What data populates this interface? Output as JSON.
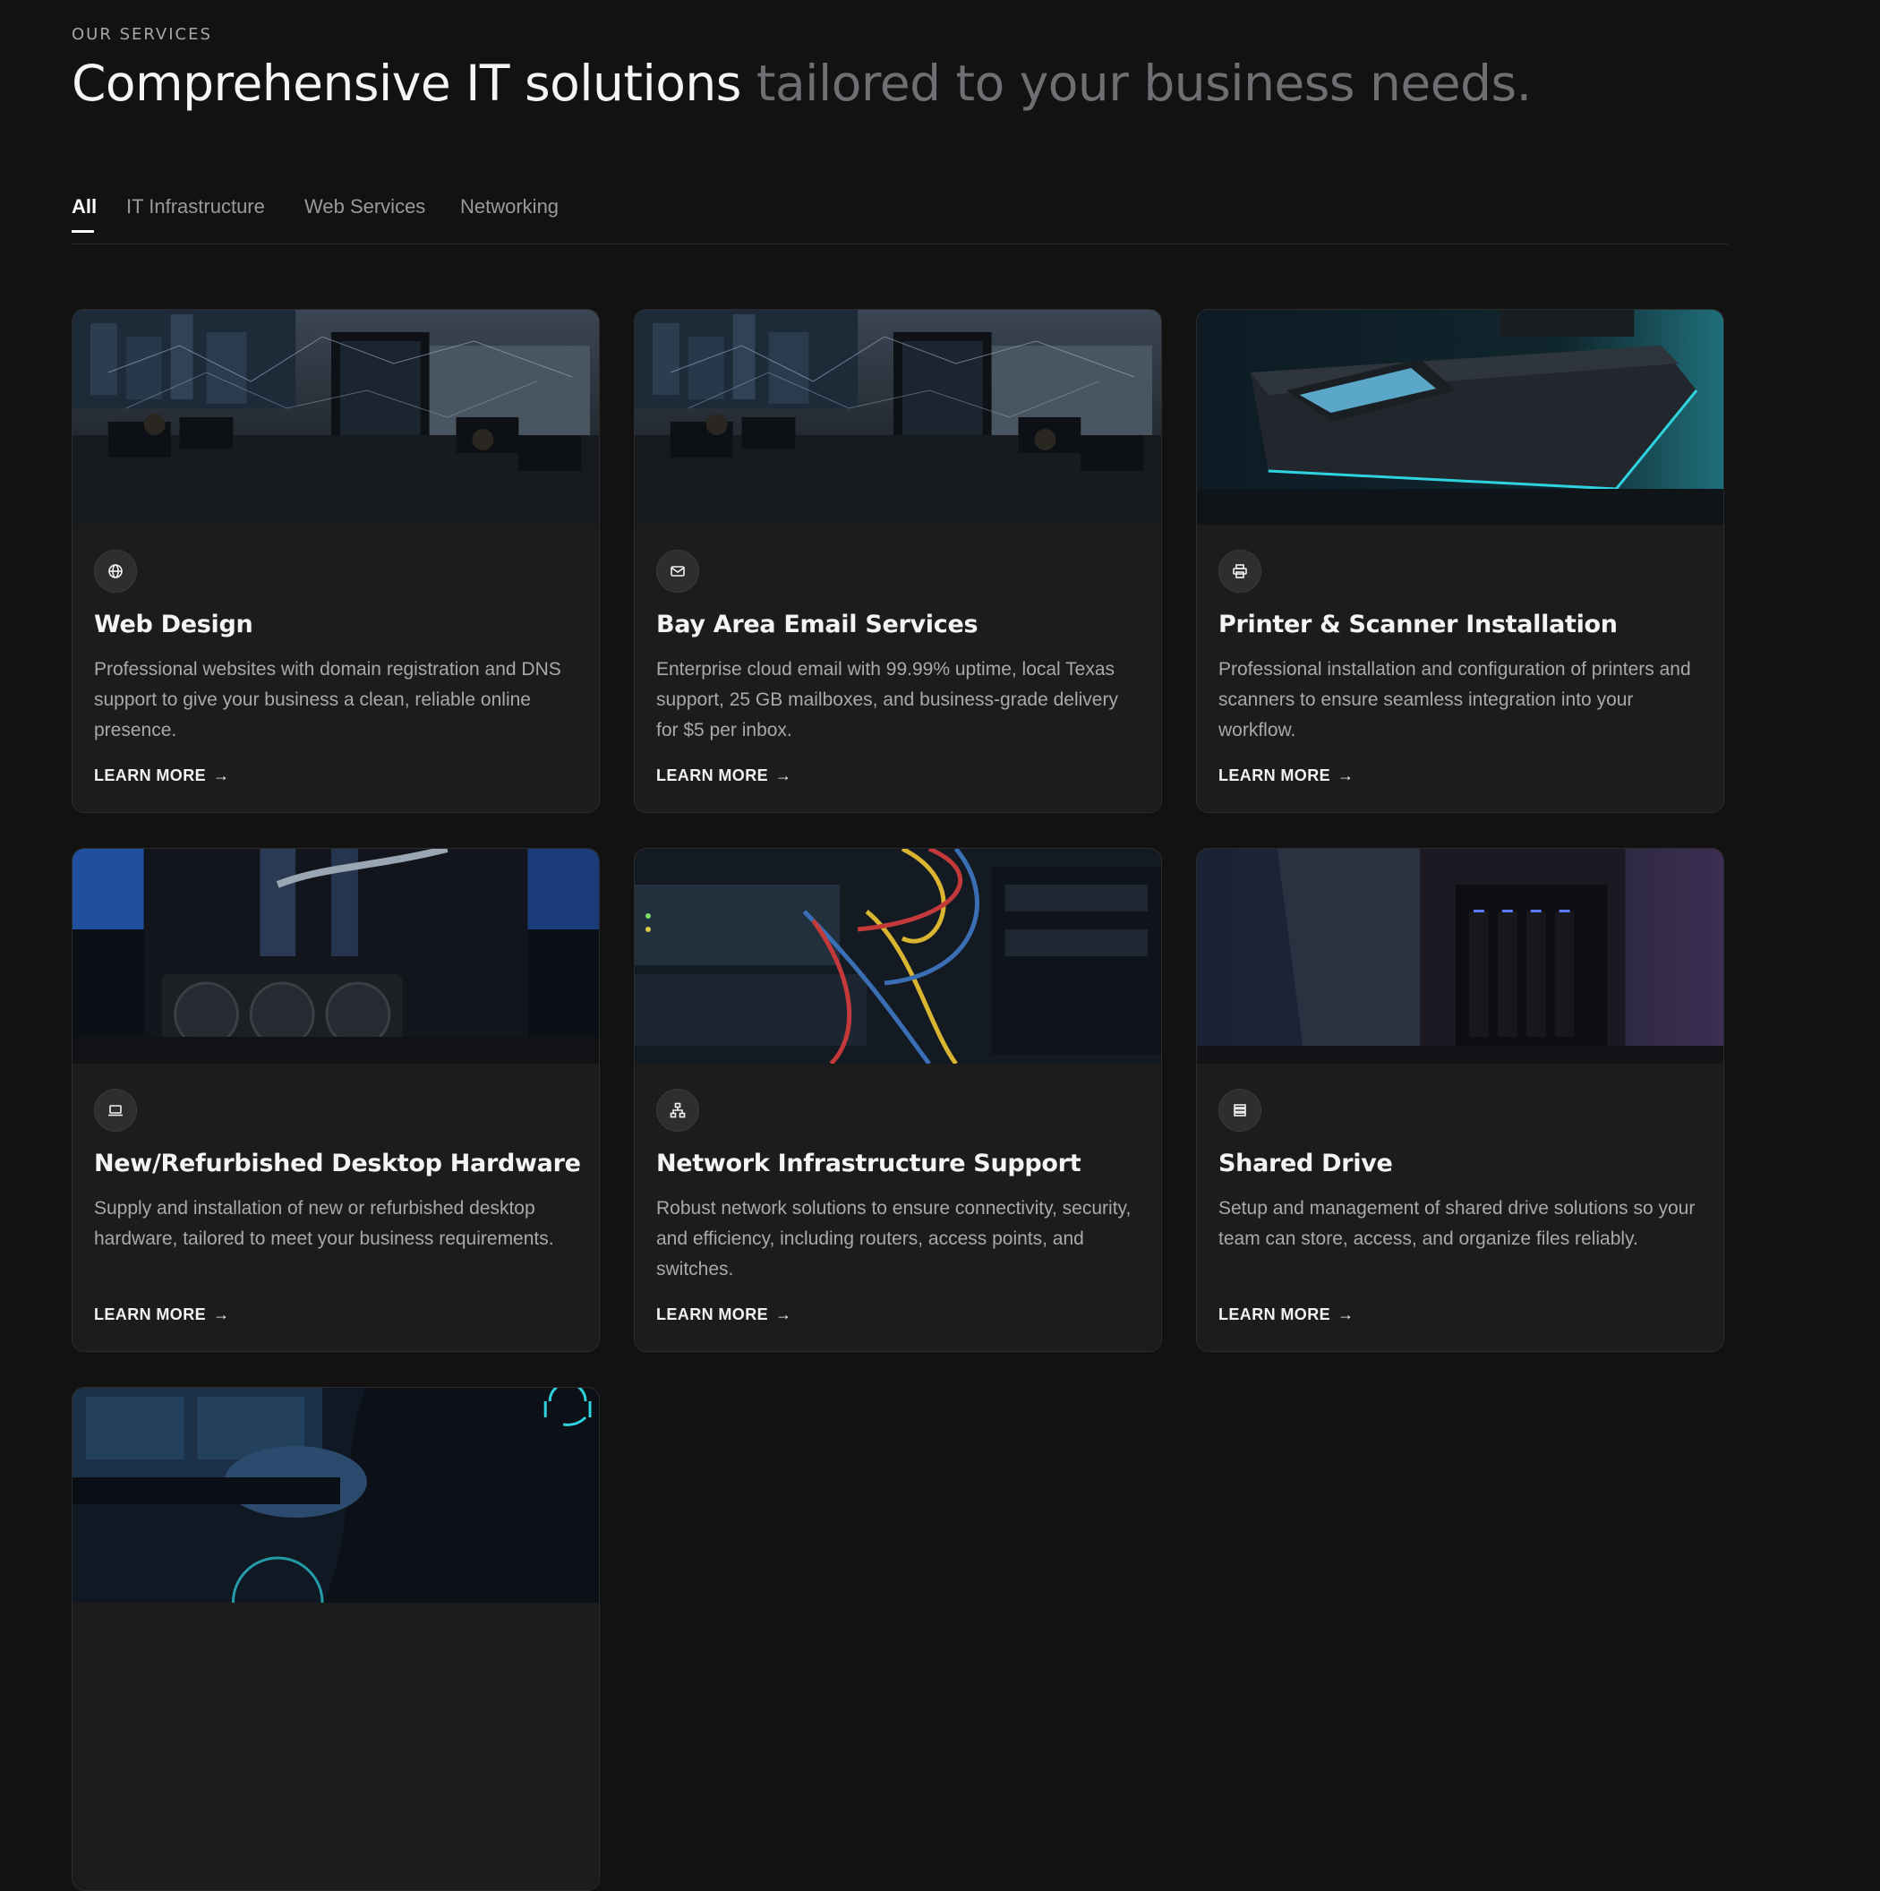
{
  "header": {
    "eyebrow": "OUR SERVICES",
    "headline_strong": "Comprehensive IT solutions",
    "headline_muted": "tailored to your business needs."
  },
  "tabs": [
    {
      "label": "All",
      "active": true
    },
    {
      "label": "IT Infrastructure",
      "active": false
    },
    {
      "label": "Web Services",
      "active": false
    },
    {
      "label": "Networking",
      "active": false
    }
  ],
  "cards": [
    {
      "title": "Web Design",
      "description": "Professional websites with domain registration and DNS support to give your business a clean, reliable online presence.",
      "cta": "LEARN MORE",
      "icon": "globe-icon",
      "image": "office-datacenter"
    },
    {
      "title": "Bay Area Email Services",
      "description": "Enterprise cloud email with 99.99% uptime, local Texas support, 25 GB mailboxes, and business-grade delivery for $5 per inbox.",
      "cta": "LEARN MORE",
      "icon": "mail-icon",
      "image": "office-datacenter"
    },
    {
      "title": "Printer & Scanner Installation",
      "description": "Professional installation and configuration of printers and scanners to ensure seamless integration into your workflow.",
      "cta": "LEARN MORE",
      "icon": "printer-icon",
      "image": "printer"
    },
    {
      "title": "New/Refurbished Desktop Hardware",
      "description": "Supply and installation of new or refurbished desktop hardware, tailored to meet your business requirements.",
      "cta": "LEARN MORE",
      "icon": "laptop-icon",
      "image": "gpu"
    },
    {
      "title": "Network Infrastructure Support",
      "description": "Robust network solutions to ensure connectivity, security, and efficiency, including routers, access points, and switches.",
      "cta": "LEARN MORE",
      "icon": "network-icon",
      "image": "network-cables"
    },
    {
      "title": "Shared Drive",
      "description": "Setup and management of shared drive solutions so your team can store, access, and organize files reliably.",
      "cta": "LEARN MORE",
      "icon": "server-icon",
      "image": "nas"
    },
    {
      "title": "",
      "description": "",
      "cta": "",
      "icon": "",
      "image": "helpdesk"
    }
  ],
  "colors": {
    "background": "#121212",
    "card": "#1c1c1c",
    "muted_text": "#6e6e73",
    "accent_cyan": "#2fd3e0"
  }
}
